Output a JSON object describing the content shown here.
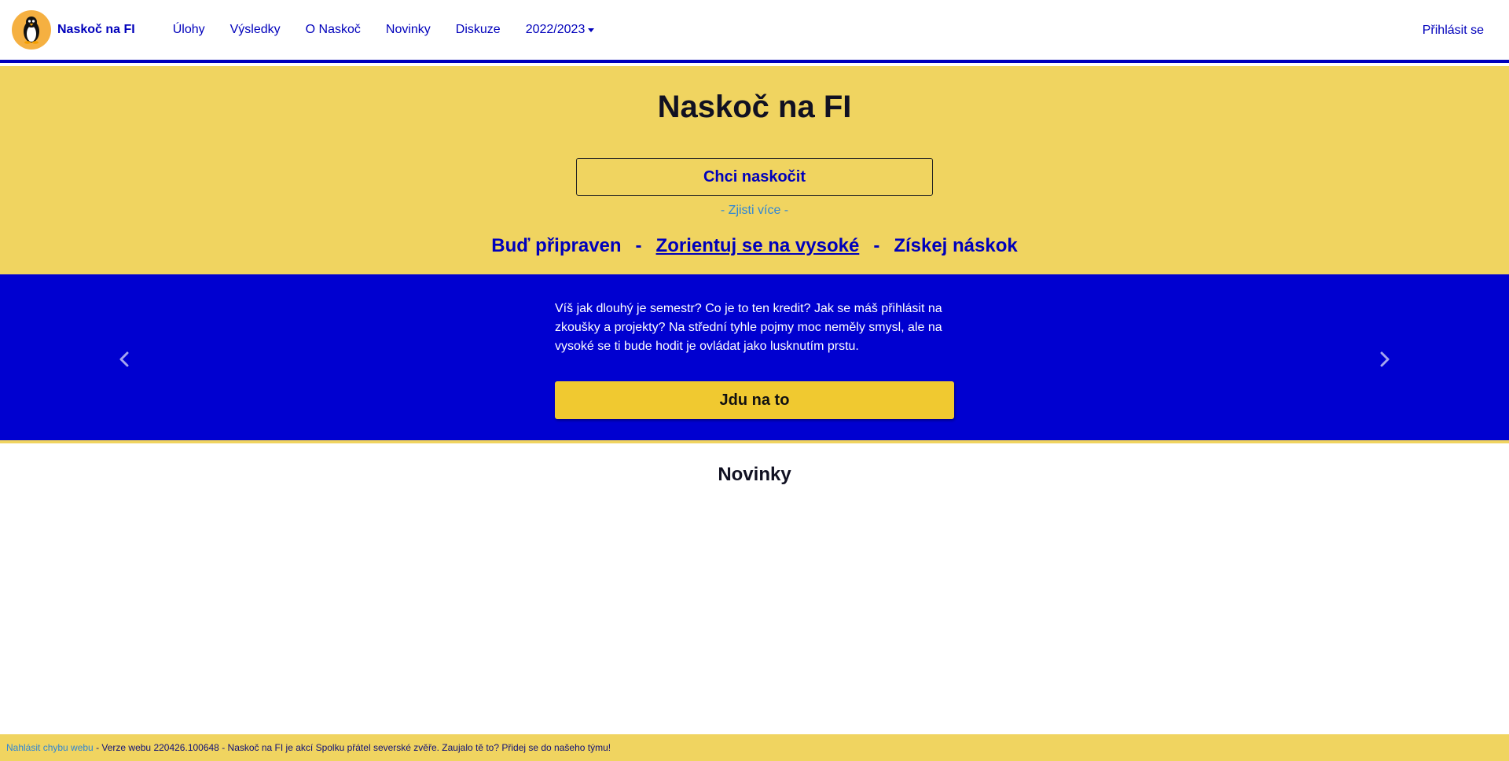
{
  "colors": {
    "brand_blue": "#0000bb",
    "carousel_blue": "#0000d0",
    "hero_yellow": "#f0d460",
    "button_yellow": "#f0c930",
    "link_light_blue": "#2e86d6",
    "logo_orange": "#f5b041"
  },
  "navbar": {
    "logo_icon": "penguin-icon",
    "brand": "Naskoč na FI",
    "links": [
      {
        "label": "Úlohy"
      },
      {
        "label": "Výsledky"
      },
      {
        "label": "O Naskoč"
      },
      {
        "label": "Novinky"
      },
      {
        "label": "Diskuze"
      }
    ],
    "year_dropdown": {
      "label": "2022/2023",
      "icon": "caret-down-icon"
    },
    "login": "Přihlásit se"
  },
  "hero": {
    "title": "Naskoč na FI",
    "cta": "Chci naskočit",
    "learn_more": "- Zjisti více -",
    "pillars": [
      "Buď připraven",
      "Zorientuj se na vysoké",
      "Získej náskok"
    ],
    "separator": "-",
    "active_pillar_index": 1
  },
  "carousel": {
    "text": "Víš jak dlouhý je semestr? Co je to ten kredit? Jak se máš přihlásit na zkoušky a projekty? Na střední tyhle pojmy moc neměly smysl, ale na vysoké se ti bude hodit je ovládat jako lusknutím prstu.",
    "button": "Jdu na to",
    "prev_icon": "chevron-left-icon",
    "next_icon": "chevron-right-icon"
  },
  "news": {
    "title": "Novinky"
  },
  "footer": {
    "report_link": "Nahlásit chybu webu",
    "text": " - Verze webu 220426.100648 - Naskoč na FI je akcí Spolku přátel severské zvěře. Zaujalo tě to? Přidej se do našeho týmu!"
  }
}
